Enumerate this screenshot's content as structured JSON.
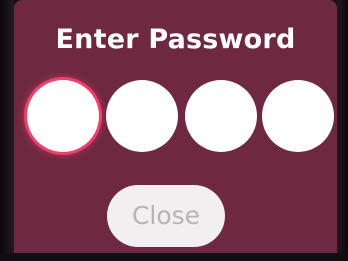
{
  "dialog": {
    "title": "Enter Password",
    "pin_count": 4,
    "focused_index": 0,
    "close_label": "Close",
    "colors": {
      "background": "#6e2840",
      "focus_ring": "#ef3f6c",
      "pin_fill": "#ffffff",
      "button_fill": "#f1eff0",
      "button_text": "#b8b3b6"
    }
  }
}
